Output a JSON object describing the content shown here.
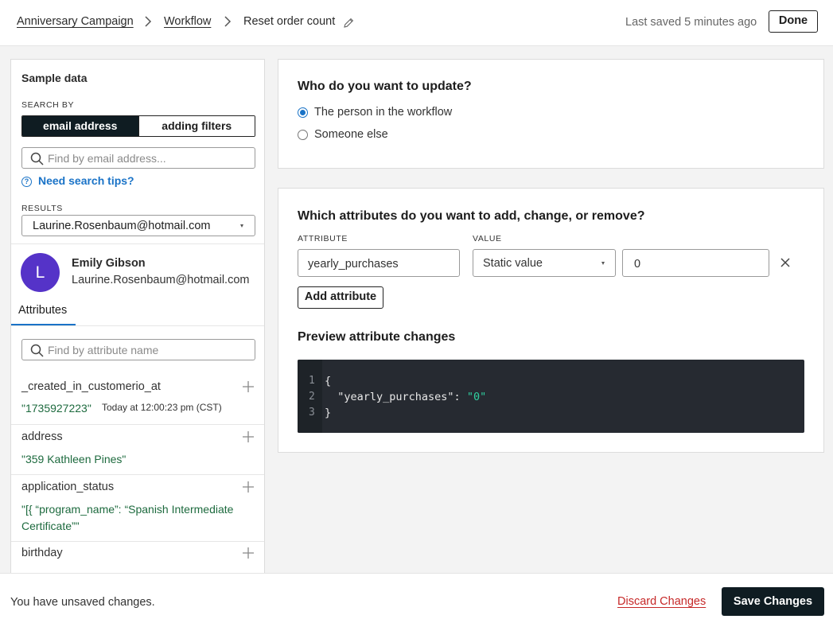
{
  "breadcrumb": {
    "items": [
      "Anniversary Campaign",
      "Workflow",
      "Reset order count"
    ]
  },
  "header": {
    "last_saved": "Last saved 5 minutes ago",
    "done_label": "Done"
  },
  "sample_data": {
    "title": "Sample data",
    "search_by_label": "SEARCH BY",
    "search_modes": [
      "email address",
      "adding filters"
    ],
    "active_mode": "email address",
    "email_search_placeholder": "Find by email address...",
    "tips_label": "Need search tips?",
    "results_label": "RESULTS",
    "selected_result": "Laurine.Rosenbaum@hotmail.com",
    "person": {
      "initial": "L",
      "name": "Emily Gibson",
      "email": "Laurine.Rosenbaum@hotmail.com"
    },
    "tab_label": "Attributes",
    "attribute_search_placeholder": "Find by attribute name",
    "attributes": [
      {
        "name": "_created_in_customerio_at",
        "value": "\"1735927223\"",
        "timestamp": "Today at 12:00:23 pm (CST)"
      },
      {
        "name": "address",
        "value": "\"359 Kathleen Pines\""
      },
      {
        "name": "application_status",
        "value": "\"[{ “program_name”: “Spanish Intermediate Certificate”\""
      },
      {
        "name": "birthday",
        "value": ""
      }
    ]
  },
  "who_update": {
    "title": "Who do you want to update?",
    "options": [
      "The person in the workflow",
      "Someone else"
    ],
    "selected": "The person in the workflow"
  },
  "attribute_changes": {
    "title": "Which attributes do you want to add, change, or remove?",
    "attribute_label": "ATTRIBUTE",
    "value_label": "VALUE",
    "attribute_value": "yearly_purchases",
    "value_type": "Static value",
    "value": "0",
    "add_button": "Add attribute",
    "preview_title": "Preview attribute changes",
    "preview_lines": [
      {
        "num": "1",
        "text": "{"
      },
      {
        "num": "2",
        "key": "  \"yearly_purchases\": ",
        "str": "\"0\""
      },
      {
        "num": "3",
        "text": "}"
      }
    ]
  },
  "footer": {
    "unsaved": "You have unsaved changes.",
    "discard": "Discard Changes",
    "save": "Save Changes"
  },
  "colors": {
    "accent": "#1a73c7",
    "dark": "#0f1c22",
    "string_green": "#1d6a3e",
    "danger": "#c62828",
    "avatar": "#5533c8"
  }
}
